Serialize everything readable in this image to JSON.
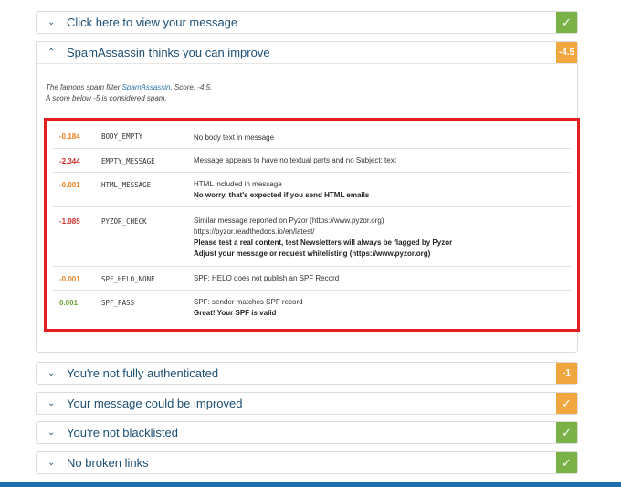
{
  "panels": {
    "message": {
      "title": "Click here to view your message",
      "badge": "✓",
      "chevron": "⌄"
    },
    "spam": {
      "title": "SpamAssassin thinks you can improve",
      "badge": "-4.5",
      "chevron": "⌃"
    },
    "auth": {
      "title": "You're not fully authenticated",
      "badge": "-1",
      "chevron": "⌄"
    },
    "improve": {
      "title": "Your message could be improved",
      "badge": "✓",
      "chevron": "⌄"
    },
    "blacklist": {
      "title": "You're not blacklisted",
      "badge": "✓",
      "chevron": "⌄"
    },
    "links": {
      "title": "No broken links",
      "badge": "✓",
      "chevron": "⌄"
    }
  },
  "spam_intro": {
    "line1_prefix": "The famous spam filter ",
    "line1_link": "SpamAssassin",
    "line1_suffix": ". Score: -4.5.",
    "line2": "A score below -5 is considered spam."
  },
  "rules": [
    {
      "score": "-0.184",
      "name": "BODY_EMPTY",
      "desc": [
        "No body text in message"
      ],
      "strong": []
    },
    {
      "score": "-2.344",
      "name": "EMPTY_MESSAGE",
      "desc": [
        "Message appears to have no textual parts and no Subject: text"
      ],
      "strong": []
    },
    {
      "score": "-0.001",
      "name": "HTML_MESSAGE",
      "desc": [
        "HTML included in message"
      ],
      "strong": [
        "No worry, that's expected if you send HTML emails"
      ]
    },
    {
      "score": "-1.985",
      "name": "PYZOR_CHECK",
      "desc": [
        "Similar message reported on Pyzor (https://www.pyzor.org)",
        "https://pyzor.readthedocs.io/en/latest/"
      ],
      "strong": [
        "Please test a real content, test Newsletters will always be flagged by Pyzor",
        "Adjust your message or request whitelisting (https://www.pyzor.org)"
      ]
    },
    {
      "score": "-0.001",
      "name": "SPF_HELO_NONE",
      "desc": [
        "SPF: HELO does not publish an SPF Record"
      ],
      "strong": []
    },
    {
      "score": "0.001",
      "name": "SPF_PASS",
      "desc": [
        "SPF: sender matches SPF record"
      ],
      "strong": [
        "Great! Your SPF is valid"
      ]
    }
  ],
  "colors": {
    "accent": "#1d4f73",
    "ok": "#7ab247",
    "warn": "#f0a740",
    "highlight_border": "#e41d21"
  }
}
